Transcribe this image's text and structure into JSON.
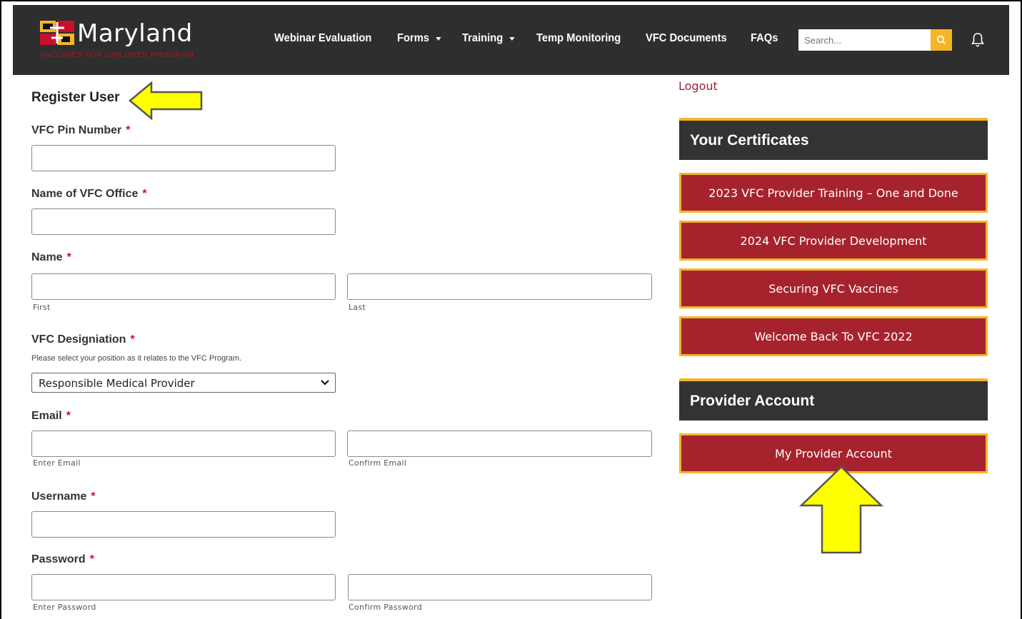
{
  "header": {
    "logo_text": "Maryland",
    "logo_subtitle": "VACCINES FOR CHILDREN PROGRAM",
    "nav": [
      {
        "label": "Webinar Evaluation"
      },
      {
        "label": "Forms"
      },
      {
        "label": "Training"
      },
      {
        "label": "Temp Monitoring"
      },
      {
        "label": "VFC Documents"
      },
      {
        "label": "FAQs"
      }
    ],
    "search_placeholder": "Search..."
  },
  "form": {
    "title": "Register User",
    "required_mark": "*",
    "pin_label": "VFC Pin Number",
    "office_label": "Name of VFC Office",
    "name_label": "Name",
    "name_first": "First",
    "name_last": "Last",
    "designation_label": "VFC Designiation",
    "designation_desc": "Please select your position as it relates to the VFC Program.",
    "designation_value": "Responsible Medical Provider",
    "email_label": "Email",
    "email_enter": "Enter Email",
    "email_confirm": "Confirm Email",
    "username_label": "Username",
    "password_label": "Password",
    "password_enter": "Enter Password",
    "password_confirm": "Confirm Password"
  },
  "sidebar": {
    "logout": "Logout",
    "certificates_title": "Your Certificates",
    "certificates": [
      "2023 VFC Provider Training – One and Done",
      "2024 VFC Provider Development",
      "Securing VFC Vaccines",
      "Welcome Back To VFC 2022"
    ],
    "account_title": "Provider Account",
    "account_button": "My Provider Account"
  },
  "colors": {
    "header_bg": "#2e2e2e",
    "accent_gold": "#f4b628",
    "button_red": "#a6232e",
    "annotation_yellow": "#ffff00"
  }
}
